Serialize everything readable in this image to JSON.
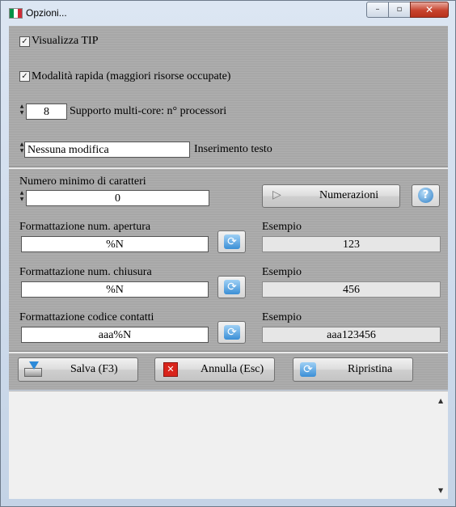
{
  "window": {
    "title": "Opzioni...",
    "controls": {
      "minimize": "–",
      "maximize": "▫",
      "close": "✕"
    },
    "flag_colors": [
      "#009246",
      "#ffffff",
      "#ce2b37"
    ]
  },
  "options": {
    "show_tip": {
      "label": "Visualizza TIP",
      "checked": true,
      "mark": "✓"
    },
    "fast_mode": {
      "label": "Modalità rapida (maggiori risorse occupate)",
      "checked": true,
      "mark": "✓"
    },
    "multicore": {
      "value": "8",
      "label": "Supporto multi-core: n° processori"
    },
    "text_insert": {
      "value": "Nessuna modifica",
      "label": "Inserimento testo"
    }
  },
  "spinner": {
    "up": "▲",
    "down": "▼"
  },
  "numbering": {
    "min_chars_label": "Numero minimo di caratteri",
    "min_chars_value": "0",
    "numerazioni_button": "Numerazioni",
    "play_icon": "▷",
    "help_icon": "?"
  },
  "formats": [
    {
      "label": "Formattazione num. apertura",
      "value": "%N",
      "example_label": "Esempio",
      "example": "123"
    },
    {
      "label": "Formattazione num. chiusura",
      "value": "%N",
      "example_label": "Esempio",
      "example": "456"
    },
    {
      "label": "Formattazione codice contatti",
      "value": "aaa%N",
      "example_label": "Esempio",
      "example": "aaa123456"
    }
  ],
  "refresh_glyph": "⟳",
  "actions": {
    "save": "Salva (F3)",
    "cancel": "Annulla (Esc)",
    "reset": "Ripristina",
    "cancel_glyph": "✕"
  },
  "scrollbar": {
    "up": "▲",
    "down": "▼"
  }
}
